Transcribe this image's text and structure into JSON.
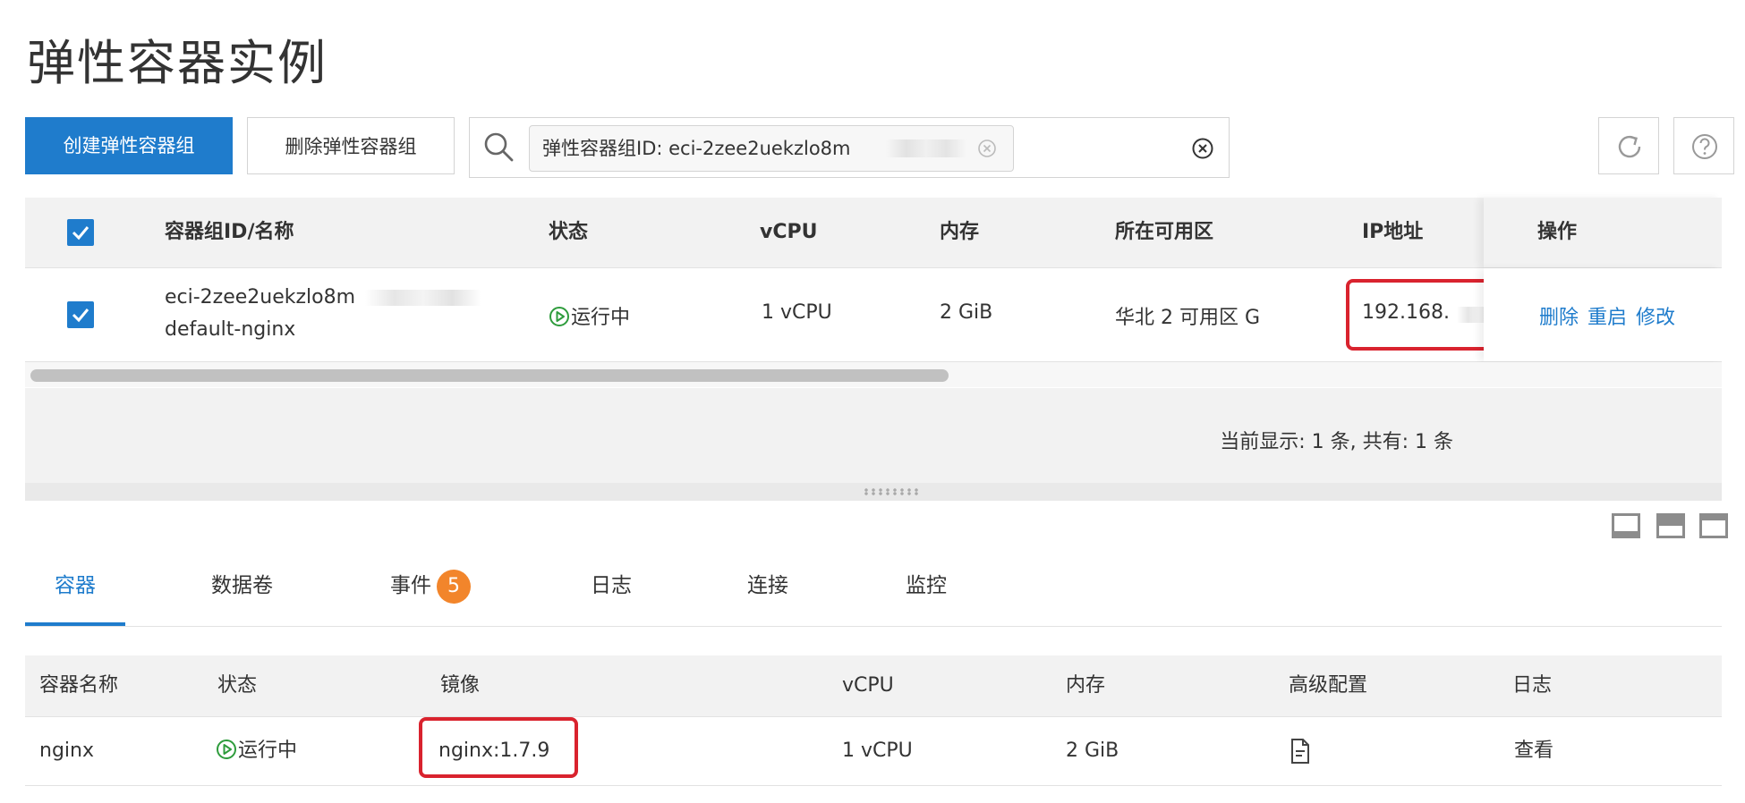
{
  "page": {
    "title": "弹性容器实例"
  },
  "toolbar": {
    "create_label": "创建弹性容器组",
    "delete_label": "删除弹性容器组",
    "search_tag": "弹性容器组ID: eci-2zee2uekzlo8m",
    "refresh_icon": "refresh-icon",
    "help_icon": "help-icon"
  },
  "group_table": {
    "columns": {
      "id_name": "容器组ID/名称",
      "status": "状态",
      "vcpu": "vCPU",
      "memory": "内存",
      "zone": "所在可用区",
      "ip": "IP地址",
      "actions": "操作"
    },
    "rows": [
      {
        "id": "eci-2zee2uekzlo8m",
        "name": "default-nginx",
        "status": "运行中",
        "vcpu": "1 vCPU",
        "memory": "2 GiB",
        "zone": "华北 2 可用区 G",
        "ip": "192.168.",
        "actions": {
          "delete": "删除",
          "restart": "重启",
          "modify": "修改"
        }
      }
    ],
    "footer": "当前显示: 1 条, 共有: 1 条"
  },
  "detail_tabs": [
    {
      "label": "容器",
      "active": true
    },
    {
      "label": "数据卷"
    },
    {
      "label": "事件",
      "badge": "5"
    },
    {
      "label": "日志"
    },
    {
      "label": "连接"
    },
    {
      "label": "监控"
    }
  ],
  "container_table": {
    "columns": {
      "name": "容器名称",
      "status": "状态",
      "image": "镜像",
      "vcpu": "vCPU",
      "memory": "内存",
      "advanced": "高级配置",
      "log": "日志"
    },
    "rows": [
      {
        "name": "nginx",
        "status": "运行中",
        "image": "nginx:1.7.9",
        "vcpu": "1 vCPU",
        "memory": "2 GiB",
        "advanced_icon": "document-icon",
        "log": "查看"
      }
    ]
  },
  "colors": {
    "primary": "#1f7ccc",
    "highlight": "#d9232e",
    "running": "#2e9c3c",
    "badge": "#f2852b"
  }
}
